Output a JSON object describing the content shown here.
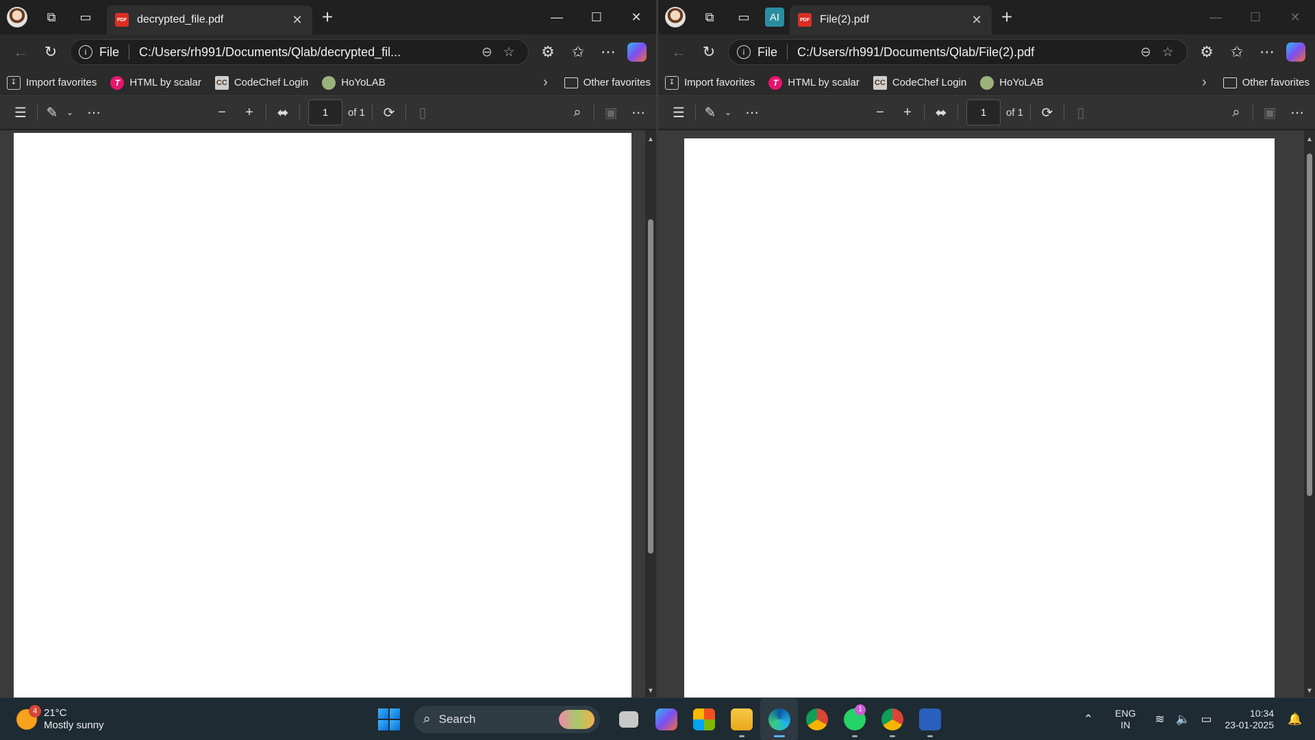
{
  "windows": {
    "left": {
      "tab_title": "decrypted_file.pdf",
      "url_scheme": "File",
      "url": "C:/Users/rh991/Documents/Qlab/decrypted_fil...",
      "page_number": "1",
      "page_count": "of 1"
    },
    "right": {
      "ai_button_label": "AI",
      "tab_title": "File(2).pdf",
      "url_scheme": "File",
      "url": "C:/Users/rh991/Documents/Qlab/File(2).pdf",
      "page_number": "1",
      "page_count": "of 1"
    }
  },
  "favorites": {
    "items": [
      "Import favorites",
      "HTML by scalar",
      "CodeChef Login",
      "HoYoLAB"
    ],
    "other": "Other favorites",
    "codechef_icon_text": "CC"
  },
  "pdf_badge": "PDF",
  "taskbar": {
    "weather_temp": "21°C",
    "weather_desc": "Mostly sunny",
    "weather_badge": "4",
    "search_label": "Search",
    "whatsapp_badge": "1",
    "language": "ENG",
    "region": "IN",
    "time": "10:34",
    "date": "23-01-2025"
  },
  "icons": [
    "avatar",
    "workspaces-icon",
    "tab-actions-icon",
    "pdf-icon",
    "close-icon",
    "new-tab-icon",
    "minimize-icon",
    "maximize-icon",
    "back-icon",
    "refresh-icon",
    "info-icon",
    "zoom-icon",
    "star-icon",
    "extensions-icon",
    "favorites-icon",
    "more-icon",
    "copilot-icon",
    "contents-icon",
    "draw-icon",
    "zoom-out-icon",
    "zoom-in-icon",
    "fit-width-icon",
    "rotate-icon",
    "page-view-icon",
    "search-icon",
    "save-icon",
    "windows-start-icon",
    "file-explorer-icon",
    "edge-icon",
    "chrome-icon",
    "whatsapp-icon",
    "word-icon",
    "wifi-icon",
    "volume-icon",
    "battery-icon",
    "notification-icon"
  ]
}
